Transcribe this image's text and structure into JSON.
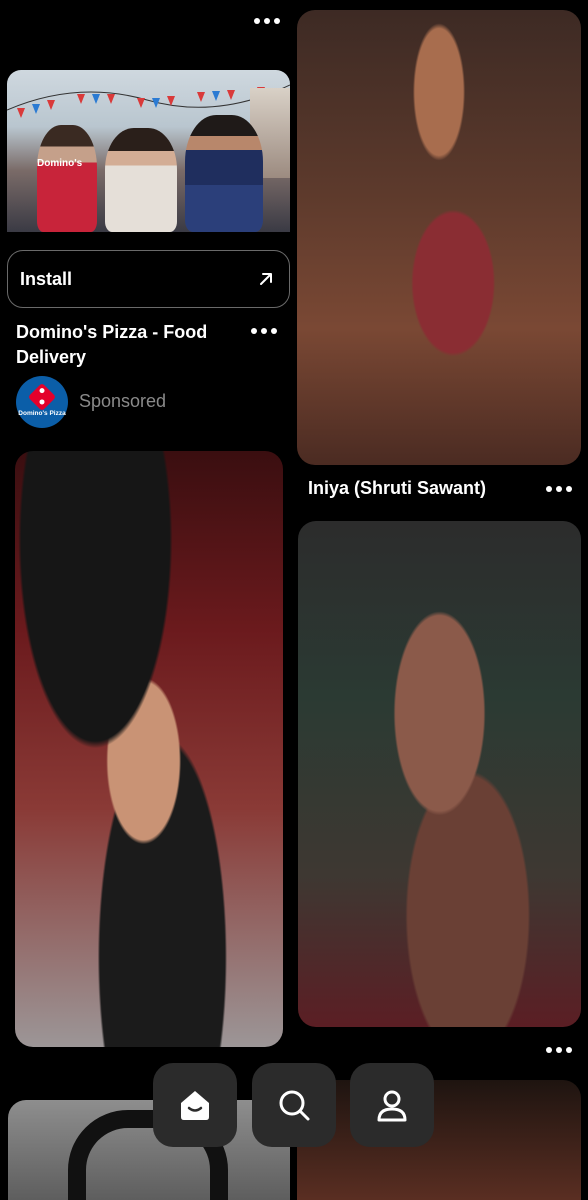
{
  "ad": {
    "image_logo_text": "Domino's",
    "install_label": "Install",
    "title": "Domino's Pizza - Food Delivery",
    "brand_avatar_text": "Domino's Pizza",
    "sponsored_label": "Sponsored"
  },
  "pins": [
    {
      "caption": "Iniya (Shruti Sawant)"
    }
  ],
  "nav": {
    "items": [
      "home",
      "search",
      "profile"
    ]
  },
  "icons": {
    "more": "more-horizontal-icon",
    "install_arrow": "arrow-up-right-icon",
    "home": "home-icon",
    "search": "search-icon",
    "profile": "profile-icon"
  },
  "colors": {
    "background": "#000000",
    "nav_button": "#2b2b2b",
    "brand_blue": "#0b5ea8",
    "brand_red": "#e4002b",
    "muted_text": "#8a8a8a"
  }
}
